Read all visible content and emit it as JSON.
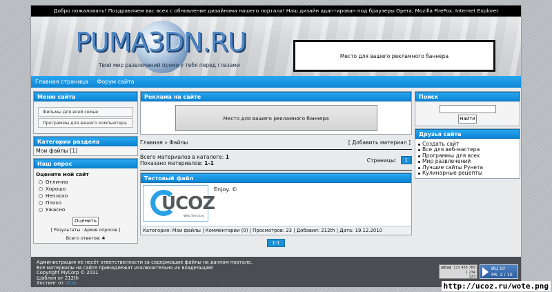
{
  "welcome": "Добро пожаловать! Поздравляем вас всех с обновление дизайнома нашего портала! Наш дизайн адаптирован под браузеры Opera, Mozilla FireFox, Internet Explorer",
  "header": {
    "logo": "PUMA3DN.RU",
    "slogan": "Твой мир развлечений прямо у тебя перед глазами",
    "banner": "Место для вашего рекламного баннера"
  },
  "nav": [
    "Главная страница",
    "Форум сайта"
  ],
  "left": {
    "menu_title": "Меню сайта",
    "menu_items": [
      "Фильмы для всей семьи",
      "Программы для вашего компьютера"
    ],
    "categories_title": "Категории раздела",
    "category": "Мои файлы [1]",
    "poll_title": "Наш опрос",
    "poll_question": "Оцените мой сайт",
    "poll_options": [
      "Отлично",
      "Хорошо",
      "Неплохо",
      "Плохо",
      "Ужасно"
    ],
    "poll_button": "Оценить",
    "poll_links": "[ Результаты · Архив опросов ]",
    "poll_total_label": "Всего ответов:",
    "poll_total_value": "4"
  },
  "mid": {
    "ad_title": "Реклама на сайте",
    "ad_banner": "Место для вашего рекламного баннера",
    "breadcrumb": "Главная » Файлы",
    "add_material": "[ Добавить материал ]",
    "total_label": "Всего материалов в каталоге:",
    "total_value": "1",
    "shown_label": "Показано материалов:",
    "shown_value": "1-1",
    "pages_label": "Страницы:",
    "page": "1",
    "entry_title": "Тестовый файл",
    "entry_logo": "UCOZ",
    "entry_logo_sub": "Web Services",
    "entry_text": "Enjoy. ©",
    "entry_meta": "Категория: Мои файлы | Комментарии (0) | Просмотров: 23 | Добавил: 212th | Дата: 19.12.2010",
    "pager_bottom": "1-1"
  },
  "right": {
    "search_title": "Поиск",
    "search_button": "Найти",
    "friends_title": "Друзья сайта",
    "friends": [
      "Создать сайт",
      "Все для веб-мастера",
      "Программы для всех",
      "Мир развлечений",
      "Лучшие сайты Рунета",
      "Кулинарные рецепты"
    ]
  },
  "footer": {
    "line1": "Администрация не несёт ответственности за содержащие файлы на данном портале.",
    "line2": "Все материалы на сайте принадлежат исключительно их владельцам!",
    "line3": "Copyright MyCorp © 2011",
    "line4": "Шаблон от 212th",
    "line5_label": "Хостинг от",
    "line5_link": "uCoz",
    "counter1_label": "uCoz",
    "counter1_values": [
      "123 456 789",
      "1 234",
      "123"
    ],
    "counter2_line1": "ИЦ 10",
    "counter2_line2": "PR: 2 / 10"
  },
  "corner_url": "http://ucoz.ru/wote.png"
}
